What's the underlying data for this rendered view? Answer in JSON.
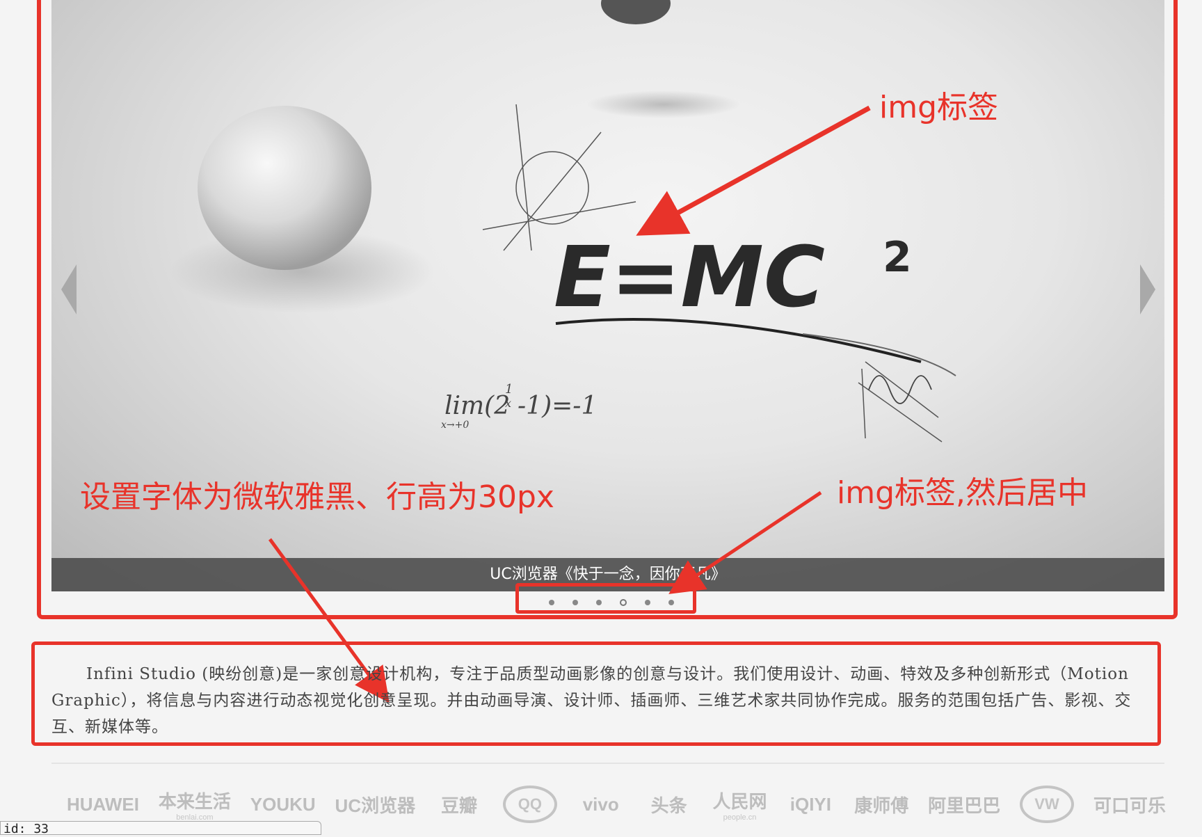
{
  "slider": {
    "caption": "UC浏览器《快于一念，因你不凡》",
    "dots": [
      {
        "active": false
      },
      {
        "active": false
      },
      {
        "active": false
      },
      {
        "active": true
      },
      {
        "active": false
      },
      {
        "active": false
      }
    ],
    "image_text": {
      "formula": "E=MC",
      "superscript": "2",
      "limit": "lim(2",
      "limit_rest": "-1)=-1",
      "limit_sub": "x→+0",
      "limit_exp_num": "1",
      "limit_exp_den": "x"
    }
  },
  "annotations": {
    "img_label": "img标签",
    "font_note": "设置字体为微软雅黑、行高为30px",
    "img_center_label": "img标签,然后居中"
  },
  "intro": {
    "text": "Infini Studio (映纷创意)是一家创意设计机构，专注于品质型动画影像的创意与设计。我们使用设计、动画、特效及多种创新形式（Motion Graphic），将信息与内容进行动态视觉化创意呈现。并由动画导演、设计师、插画师、三维艺术家共同协作完成。服务的范围包括广告、影视、交互、新媒体等。"
  },
  "partners": {
    "logos": [
      {
        "name": "huawei",
        "text": "HUAWEI"
      },
      {
        "name": "benlai",
        "text": "本来生活",
        "sub": "benlai.com"
      },
      {
        "name": "youku",
        "text": "YOUKU"
      },
      {
        "name": "uc-browser",
        "text": "UC浏览器"
      },
      {
        "name": "douban",
        "text": "豆瓣"
      },
      {
        "name": "qq",
        "text": "QQ"
      },
      {
        "name": "vivo",
        "text": "vivo"
      },
      {
        "name": "toutiao",
        "text": "头条"
      },
      {
        "name": "people",
        "text": "人民网",
        "sub": "people.cn"
      },
      {
        "name": "iqiyi",
        "text": "iQIYI"
      },
      {
        "name": "kangshifu",
        "text": "康师傅"
      },
      {
        "name": "alibaba",
        "text": "阿里巴巴"
      },
      {
        "name": "volkswagen",
        "text": "VW"
      },
      {
        "name": "cocacola",
        "text": "可口可乐"
      }
    ]
  },
  "status": {
    "text": "id: 33"
  }
}
